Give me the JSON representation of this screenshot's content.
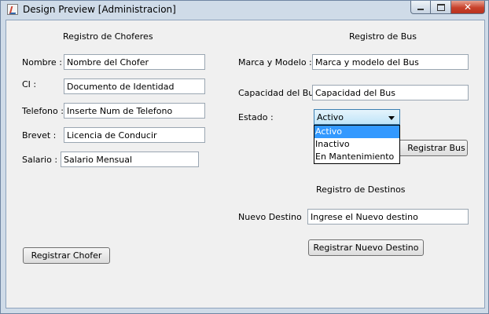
{
  "window": {
    "title": "Design Preview [Administracion]",
    "close_glyph": "✕"
  },
  "choferes": {
    "heading": "Registro de Choferes",
    "nombre_label": "Nombre :",
    "nombre_value": "Nombre del Chofer",
    "ci_label": "CI :",
    "ci_value": "Documento de Identidad",
    "telefono_label": "Telefono :",
    "telefono_value": "Inserte Num de Telefono",
    "brevet_label": "Brevet :",
    "brevet_value": "Licencia de Conducir",
    "salario_label": "Salario :",
    "salario_value": "Salario Mensual",
    "button": "Registrar Chofer"
  },
  "bus": {
    "heading": "Registro de Bus",
    "marca_label": "Marca y Modelo :",
    "marca_value": "Marca y modelo del Bus",
    "capacidad_label": "Capacidad del Bus:",
    "capacidad_value": "Capacidad del Bus",
    "estado_label": "Estado :",
    "estado_selected": "Activo",
    "estado_options": [
      "Activo",
      "Inactivo",
      "En Mantenimiento"
    ],
    "button": "Registrar Bus"
  },
  "destinos": {
    "heading": "Registro de Destinos",
    "nuevo_label": "Nuevo Destino",
    "nuevo_value": "Ingrese el Nuevo destino",
    "button": "Registrar Nuevo Destino"
  }
}
